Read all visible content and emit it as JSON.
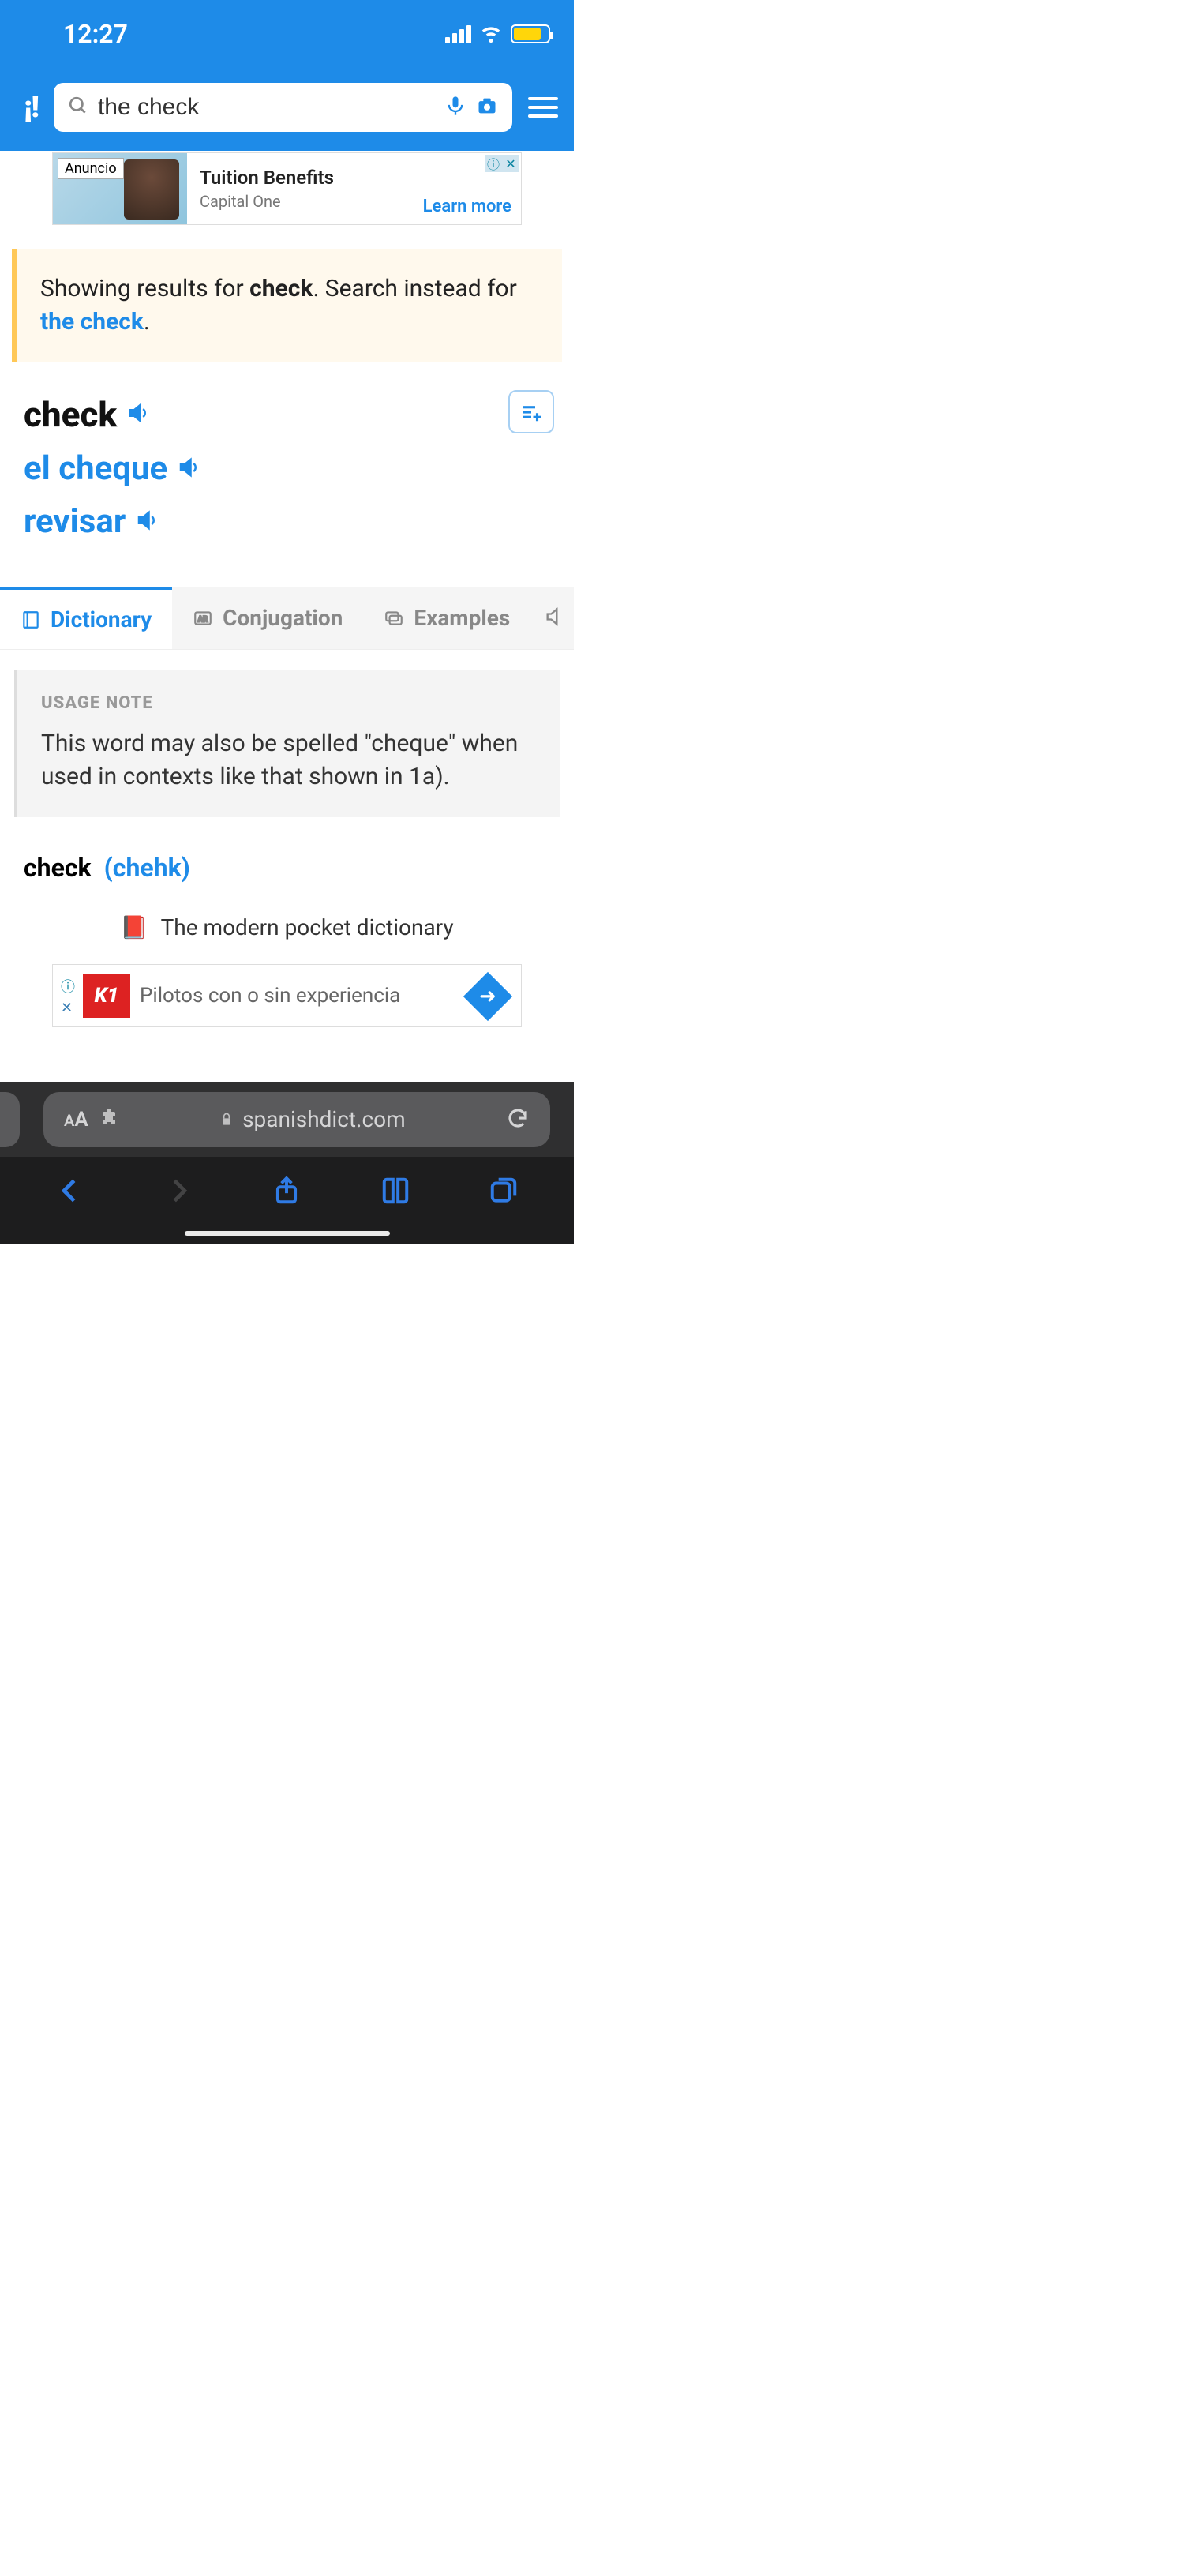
{
  "status": {
    "time": "12:27"
  },
  "header": {
    "logo": "¡!",
    "search_value": "the check"
  },
  "ad_top": {
    "label": "Anuncio",
    "title": "Tuition Benefits",
    "subtitle": "Capital One",
    "cta": "Learn more"
  },
  "notice": {
    "prefix": "Showing results for ",
    "bold": "check",
    "middle": ". Search instead for ",
    "link": "the check",
    "suffix": "."
  },
  "headwords": {
    "english": "check",
    "spanish1": "el cheque",
    "spanish2": "revisar"
  },
  "tabs": {
    "dictionary": "Dictionary",
    "conjugation": "Conjugation",
    "examples": "Examples"
  },
  "usage_note": {
    "title": "USAGE NOTE",
    "body": "This word may also be spelled \"cheque\" when used in contexts like that shown in 1a)."
  },
  "entry": {
    "word": "check",
    "pron": "(chehk)"
  },
  "tagline": "The modern pocket dictionary",
  "ad_bottom": {
    "logo": "K1",
    "text": "Pilotos con o sin experiencia"
  },
  "safari": {
    "aa": "AA",
    "domain": "spanishdict.com"
  }
}
